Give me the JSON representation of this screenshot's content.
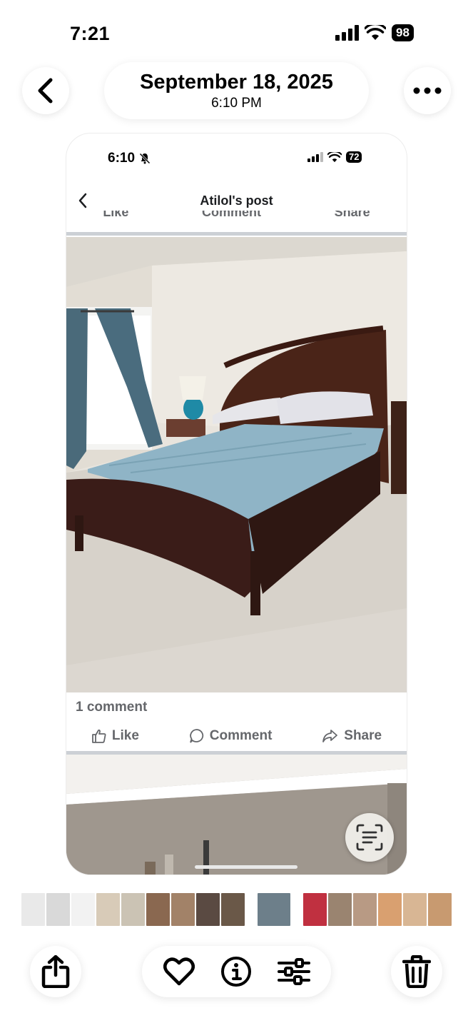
{
  "status_bar": {
    "time": "7:21",
    "battery": "98",
    "icons": [
      "cellular-signal-icon",
      "wifi-icon",
      "battery-icon"
    ]
  },
  "header": {
    "back_icon": "chevron-left-icon",
    "date": "September 18, 2025",
    "time": "6:10 PM",
    "more_icon": "ellipsis-icon"
  },
  "screenshot": {
    "status_time": "6:10",
    "status_battery": "72",
    "post_title": "Atilol's post",
    "ghost_actions": [
      "Like",
      "Comment",
      "Share"
    ],
    "comment_count": "1 comment",
    "actions": [
      {
        "label": "Like",
        "icon": "thumbs-up-icon"
      },
      {
        "label": "Comment",
        "icon": "speech-bubble-icon"
      },
      {
        "label": "Share",
        "icon": "share-arrow-icon"
      }
    ],
    "photo_subject": "bedroom-with-sleigh-bed"
  },
  "live_text_icon": "live-text-icon",
  "thumbnails": [
    {
      "color": "#e9e9e9",
      "selected": false
    },
    {
      "color": "#d9d9d9",
      "selected": false
    },
    {
      "color": "#f2f2f2",
      "selected": false
    },
    {
      "color": "#d8cbb8",
      "selected": false
    },
    {
      "color": "#cbc3b4",
      "selected": false
    },
    {
      "color": "#8a6850",
      "selected": false
    },
    {
      "color": "#a28268",
      "selected": false
    },
    {
      "color": "#5a4a42",
      "selected": false
    },
    {
      "color": "#6a5848",
      "selected": false
    },
    {
      "color": "#ffffff",
      "selected": false
    },
    {
      "color": "#6d7f8a",
      "selected": true
    },
    {
      "color": "#ffffff",
      "selected": false
    },
    {
      "color": "#c03040",
      "selected": false
    },
    {
      "color": "#9a8470",
      "selected": false
    },
    {
      "color": "#b89a84",
      "selected": false
    },
    {
      "color": "#d9a070",
      "selected": false
    },
    {
      "color": "#d8b694",
      "selected": false
    },
    {
      "color": "#c89a70",
      "selected": false
    },
    {
      "color": "#b4886a",
      "selected": false
    },
    {
      "color": "#6ea0c8",
      "selected": false
    },
    {
      "color": "#e0e0e0",
      "selected": false
    }
  ],
  "toolbar": {
    "share_icon": "share-icon",
    "favorite_icon": "heart-icon",
    "info_icon": "info-icon",
    "adjust_icon": "sliders-icon",
    "delete_icon": "trash-icon"
  },
  "colors": {
    "accent": "#000000",
    "facebook_gray": "#65676b",
    "comforter_blue": "#8fb4c6",
    "bed_wood": "#3f2220"
  }
}
